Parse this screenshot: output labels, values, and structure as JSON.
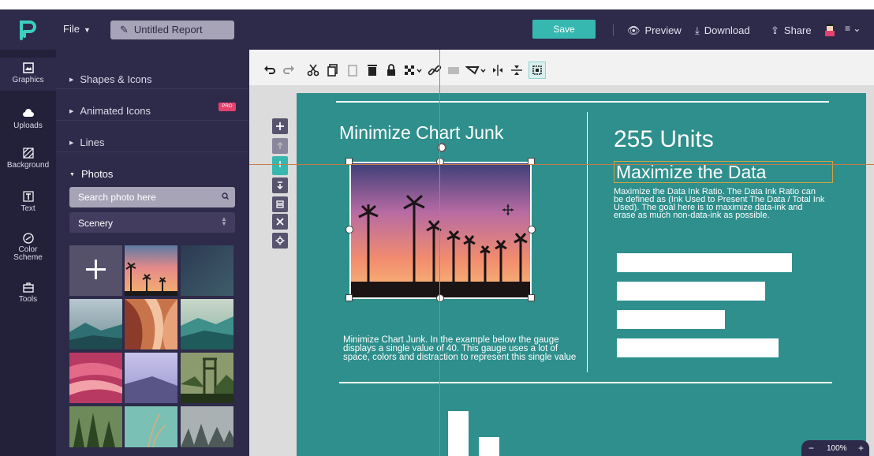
{
  "topbar": {
    "file_label": "File",
    "report_title": "Untitled Report",
    "save_label": "Save",
    "preview_label": "Preview",
    "download_label": "Download",
    "share_label": "Share"
  },
  "rail": {
    "items": [
      {
        "label": "Graphics",
        "icon": "image-icon"
      },
      {
        "label": "Uploads",
        "icon": "cloud-upload-icon"
      },
      {
        "label": "Background",
        "icon": "pattern-icon"
      },
      {
        "label": "Text",
        "icon": "text-icon"
      },
      {
        "label": "Color\nScheme",
        "icon": "palette-icon"
      },
      {
        "label": "Tools",
        "icon": "toolbox-icon"
      }
    ]
  },
  "panel": {
    "sections": [
      {
        "label": "Shapes & Icons",
        "expanded": false
      },
      {
        "label": "Animated Icons",
        "expanded": false,
        "badge": "PRO"
      },
      {
        "label": "Lines",
        "expanded": false
      },
      {
        "label": "Photos",
        "expanded": true
      }
    ],
    "search_placeholder": "Search photo here",
    "category": "Scenery"
  },
  "slide": {
    "title": "Minimize Chart Junk",
    "left_body": "Minimize Chart Junk. In the example below the gauge displays a single value of 40. This gauge uses a lot of space, colors and distraction to represent this single value",
    "stat": "255 Units",
    "subtitle": "Maximize the Data",
    "right_body": "Maximize the Data Ink Ratio. The Data Ink Ratio can be defined as (Ink Used to Present The Data / Total Ink Used). The goal here is to maximize data-ink and erase as much non-data-ink as possible."
  },
  "zoom": {
    "minus": "−",
    "value": "100%",
    "plus": "+"
  },
  "colors": {
    "topbar": "#2e2a4a",
    "rail": "#23203a",
    "accent": "#36b7b0",
    "slide_bg": "#2e8f8c",
    "pro_badge": "#e6416d",
    "selection_outline": "#d6a442",
    "guide": "#c77b48"
  }
}
